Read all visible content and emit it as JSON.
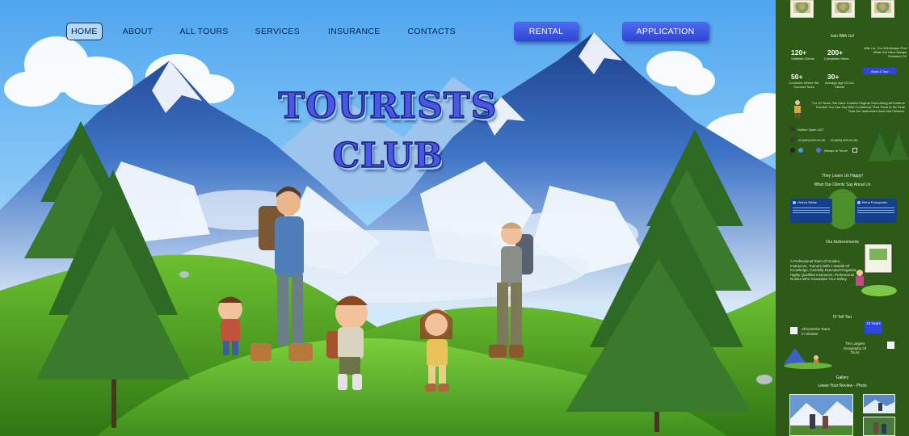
{
  "nav": {
    "items": [
      {
        "label": "HOME",
        "active": true
      },
      {
        "label": "ABOUT"
      },
      {
        "label": "ALL TOURS"
      },
      {
        "label": "SERVICES"
      },
      {
        "label": "INSURANCE"
      },
      {
        "label": "CONTACTS"
      }
    ]
  },
  "header": {
    "rental_label": "RENTAL",
    "application_label": "APPLICATION"
  },
  "hero": {
    "title_line1": "TOURISTS",
    "title_line2": "CLUB"
  },
  "colors": {
    "accent_blue": "#3a52e2",
    "panel_green": "#2e5a17",
    "title_blue": "#4a56e6",
    "grass": "#5cb32a"
  },
  "panel": {
    "join_label": "Join With Us!",
    "stats": [
      {
        "value": "120+",
        "label": "Satisfied Clients"
      },
      {
        "value": "200+",
        "label": "Completed Hikes"
      },
      {
        "value": "50+",
        "label": "Countries Where We Conduct Tours"
      },
      {
        "value": "30+",
        "label": "Average Age Of Our Clients"
      }
    ],
    "promo_text": "With Us, You Will Always Find What You Have Always Dreamed Of!",
    "book_button": "Book A Tour",
    "story_text": "For 10 Years, We Have Created Original Tours Along All Extreme Routes! You Can Say With Confidence That There Is No Peak That Our Instructors Have Not Climbed.",
    "hotline": "Hotline Open 24/7",
    "phone1": "+8 (000) 000-00-00",
    "phone2": "+8 (000) 000-00-00",
    "always_touch": "Always In Touch",
    "reviews_heading": "They Leave Us Happy!",
    "reviews_subheading": "What Our Clients Say About Us",
    "reviewers": [
      "Helena Stefan",
      "Elena Prokopenko"
    ],
    "achievements_heading": "Our Achievements",
    "achievements_text": "A Professional Team Of Guides, Instructors, Trainers With A Wealth Of Knowledge, Carefully Executed Programs, Highly Qualified Instructors, Professional Guides Who Guarantee Your Safety.",
    "tell_heading": "I'll Tell You",
    "tell_item1": "All Extreme Tours In Ukraine",
    "tell_badge": "10 Years",
    "tell_item2": "The Largest Geography Of Tours",
    "gallery_heading": "Gallery",
    "gallery_sub": "Leave Your Review - Photo"
  }
}
